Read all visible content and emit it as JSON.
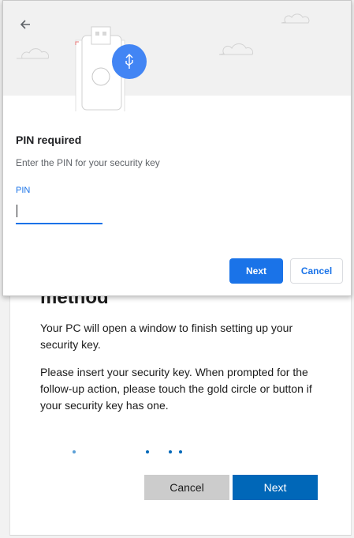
{
  "background_page": {
    "title": "method",
    "paragraph_1": "Your PC will open a window to finish setting up your security key.",
    "paragraph_2": "Please insert your security key. When prompted for the follow-up action, please touch the gold circle or button if your security key has one.",
    "cancel_label": "Cancel",
    "next_label": "Next",
    "colors": {
      "primary_button": "#0067b8",
      "secondary_button": "#cccccc"
    }
  },
  "dialog": {
    "back_icon": "arrow-left-icon",
    "illustration_icons": [
      "usb-security-key-icon",
      "usb-icon",
      "cloud-icon"
    ],
    "title": "PIN required",
    "description": "Enter the PIN for your security key",
    "pin_label": "PIN",
    "pin_value": "",
    "next_label": "Next",
    "cancel_label": "Cancel",
    "colors": {
      "accent": "#1a73e8",
      "header_bg": "#f1f1f1"
    }
  }
}
